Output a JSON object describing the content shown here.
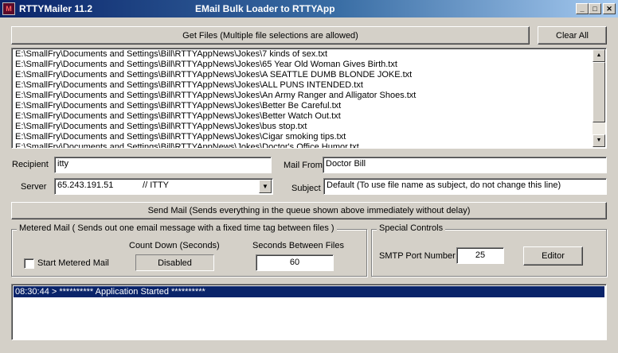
{
  "titlebar": {
    "app_title": "RTTYMailer 11.2",
    "subtitle": "EMail Bulk Loader to RTTYApp",
    "minimize": "_",
    "maximize": "□",
    "close": "✕",
    "icon_glyph": "M"
  },
  "toolbar": {
    "get_files_label": "Get Files (Multiple file selections are allowed)",
    "clear_all_label": "Clear All"
  },
  "file_list": {
    "items": [
      "E:\\SmallFry\\Documents and Settings\\Bill\\RTTYAppNews\\Jokes\\7 kinds of sex.txt",
      "E:\\SmallFry\\Documents and Settings\\Bill\\RTTYAppNews\\Jokes\\65 Year Old Woman Gives Birth.txt",
      "E:\\SmallFry\\Documents and Settings\\Bill\\RTTYAppNews\\Jokes\\A SEATTLE DUMB BLONDE JOKE.txt",
      "E:\\SmallFry\\Documents and Settings\\Bill\\RTTYAppNews\\Jokes\\ALL PUNS INTENDED.txt",
      "E:\\SmallFry\\Documents and Settings\\Bill\\RTTYAppNews\\Jokes\\An Army Ranger and Alligator Shoes.txt",
      "E:\\SmallFry\\Documents and Settings\\Bill\\RTTYAppNews\\Jokes\\Better Be Careful.txt",
      "E:\\SmallFry\\Documents and Settings\\Bill\\RTTYAppNews\\Jokes\\Better Watch Out.txt",
      "E:\\SmallFry\\Documents and Settings\\Bill\\RTTYAppNews\\Jokes\\bus stop.txt",
      "E:\\SmallFry\\Documents and Settings\\Bill\\RTTYAppNews\\Jokes\\Cigar smoking tips.txt",
      "E:\\SmallFry\\Documents and Settings\\Bill\\RTTYAppNews\\Jokes\\Doctor's Office Humor.txt"
    ],
    "scroll_up": "▲",
    "scroll_down": "▼"
  },
  "form": {
    "recipient_label": "Recipient",
    "recipient_value": "itty",
    "server_label": "Server",
    "server_value": "65.243.191.51            // ITTY",
    "mail_from_label": "Mail From",
    "mail_from_value": "Doctor Bill",
    "subject_label": "Subject",
    "subject_value": "Default (To use file name as subject, do not change this line)",
    "dropdown_arrow": "▼"
  },
  "send_mail_label": "Send Mail  (Sends everything in the queue shown above immediately without delay)",
  "metered": {
    "group_title": "Metered Mail  ( Sends out one email message with a fixed time tag between files )",
    "countdown_label": "Count Down (Seconds)",
    "countdown_value": "Disabled",
    "seconds_label": "Seconds Between Files",
    "seconds_value": "60",
    "start_label": "Start Metered Mail",
    "start_checked": false
  },
  "special": {
    "group_title": "Special Controls",
    "smtp_label": "SMTP Port Number",
    "smtp_value": "25",
    "editor_label": "Editor"
  },
  "log": {
    "lines": [
      "08:30:44 > ********** Application Started **********"
    ]
  },
  "colors": {
    "titlebar_start": "#0a246a",
    "titlebar_end": "#a6caf0",
    "face": "#d4d0c8",
    "selection": "#0a246a"
  }
}
